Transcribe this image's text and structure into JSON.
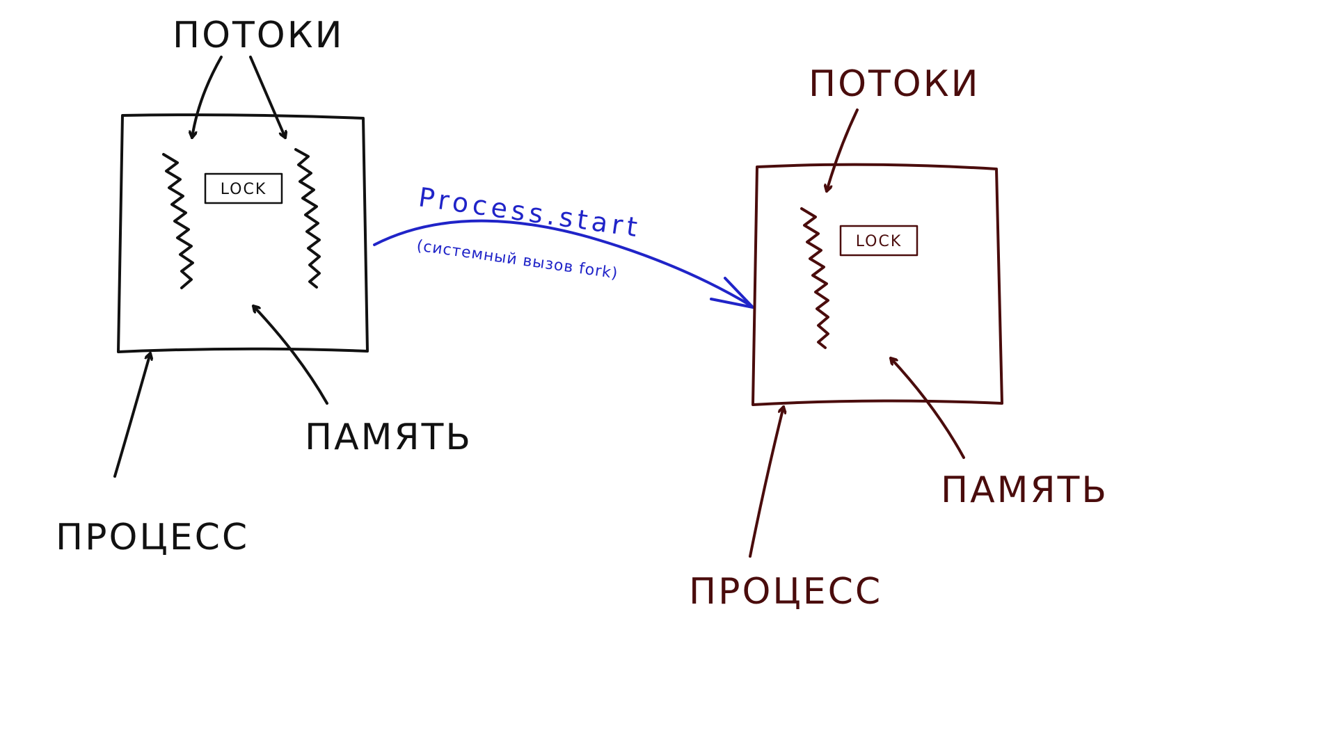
{
  "colors": {
    "parent": "#111111",
    "child": "#4a0c0c",
    "call": "#2024c8",
    "background": "#ffffff"
  },
  "parent": {
    "threads_label": "ПОТОКИ",
    "lock_label": "LOCK",
    "memory_label": "ПАМЯТЬ",
    "process_label": "ПРОЦЕСС"
  },
  "child": {
    "threads_label": "ПОТОКИ",
    "lock_label": "LOCK",
    "memory_label": "ПАМЯТЬ",
    "process_label": "ПРОЦЕСС"
  },
  "call": {
    "label": "Process.start",
    "sublabel": "(системный вызов fork)"
  }
}
